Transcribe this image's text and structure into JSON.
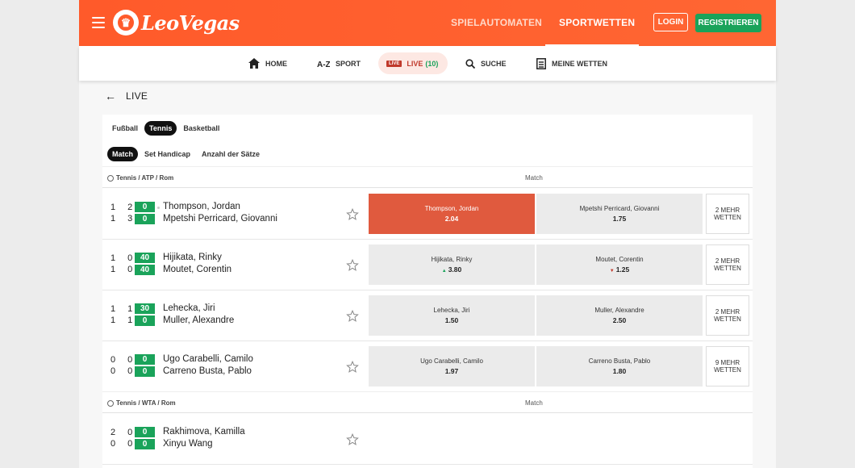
{
  "header": {
    "brand": "LeoVegas",
    "nav": [
      "SPIELAUTOMATEN",
      "SPORTWETTEN"
    ],
    "login_label": "LOGIN",
    "register_label": "REGISTRIEREN"
  },
  "subnav": {
    "home": "HOME",
    "sport": "SPORT",
    "live_badge": "LIVE",
    "live": "LIVE",
    "live_count": "(10)",
    "suche": "SUCHE",
    "wetten": "MEINE WETTEN"
  },
  "page": {
    "title": "LIVE"
  },
  "sport_filters": [
    "Fußball",
    "Tennis",
    "Basketball"
  ],
  "market_filters": [
    "Match",
    "Set Handicap",
    "Anzahl der Sätze"
  ],
  "sections": [
    {
      "label": "Tennis / ATP / Rom",
      "market": "Match",
      "matches": [
        {
          "p1": "Thompson, Jordan",
          "p2": "Mpetshi Perricard, Giovanni",
          "s1": "1 2",
          "s2": "1 3",
          "g1": "0",
          "g2": "0",
          "o1_name": "Thompson, Jordan",
          "o1": "2.04",
          "o2_name": "Mpetshi Perricard, Giovanni",
          "o2": "1.75",
          "more": "2 MEHR WETTEN"
        },
        {
          "p1": "Hijikata, Rinky",
          "p2": "Moutet, Corentin",
          "s1": "1 0",
          "s2": "1 0",
          "g1": "40",
          "g2": "40",
          "o1_name": "Hijikata, Rinky",
          "o1": "3.80",
          "o2_name": "Moutet, Corentin",
          "o2": "1.25",
          "more": "2 MEHR WETTEN"
        },
        {
          "p1": "Lehecka, Jiri",
          "p2": "Muller, Alexandre",
          "s1": "1 1",
          "s2": "1 1",
          "g1": "30",
          "g2": "0",
          "o1_name": "Lehecka, Jiri",
          "o1": "1.50",
          "o2_name": "Muller, Alexandre",
          "o2": "2.50",
          "more": "2 MEHR WETTEN"
        },
        {
          "p1": "Ugo Carabelli, Camilo",
          "p2": "Carreno Busta, Pablo",
          "s1": "0 0",
          "s2": "0 0",
          "g1": "0",
          "g2": "0",
          "o1_name": "Ugo Carabelli, Camilo",
          "o1": "1.97",
          "o2_name": "Carreno Busta, Pablo",
          "o2": "1.80",
          "more": "9 MEHR WETTEN"
        }
      ]
    },
    {
      "label": "Tennis / WTA / Rom",
      "market": "Match",
      "matches": [
        {
          "p1": "Rakhimova, Kamilla",
          "p2": "Xinyu Wang",
          "s1": "2 0",
          "s2": "0 0",
          "g1": "0",
          "g2": "0"
        }
      ]
    }
  ],
  "colors": {
    "brand": "#ff5a2a",
    "green": "#1aa35a",
    "selected_odd": "#e05a3e"
  }
}
